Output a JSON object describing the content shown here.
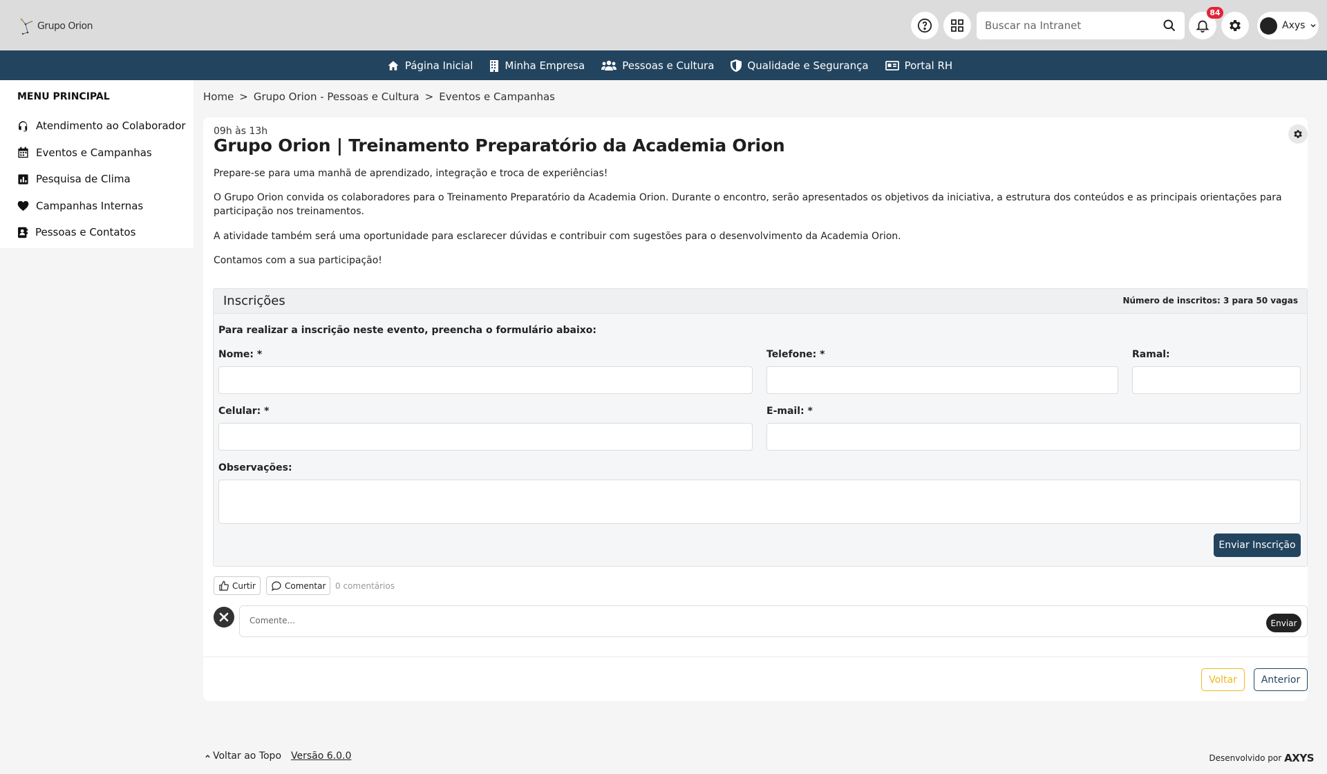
{
  "header": {
    "logo_text": "Grupo Orion",
    "search_placeholder": "Buscar na Intranet",
    "notifications_count": "84",
    "user_name": "Axys"
  },
  "nav": {
    "items": [
      {
        "label": "Página Inicial",
        "icon": "home-icon"
      },
      {
        "label": "Minha Empresa",
        "icon": "building-icon"
      },
      {
        "label": "Pessoas e Cultura",
        "icon": "users-icon"
      },
      {
        "label": "Qualidade e Segurança",
        "icon": "shield-icon"
      },
      {
        "label": "Portal RH",
        "icon": "id-card-icon"
      }
    ]
  },
  "sidebar": {
    "title": "MENU PRINCIPAL",
    "items": [
      {
        "label": "Atendimento ao Colaborador",
        "icon": "headset-icon"
      },
      {
        "label": "Eventos e Campanhas",
        "icon": "calendar-icon"
      },
      {
        "label": "Pesquisa de Clima",
        "icon": "chart-icon"
      },
      {
        "label": "Campanhas Internas",
        "icon": "heart-icon"
      },
      {
        "label": "Pessoas e Contatos",
        "icon": "contact-icon"
      }
    ]
  },
  "breadcrumb": {
    "items": [
      "Home",
      "Grupo Orion - Pessoas e Cultura",
      "Eventos e Campanhas"
    ],
    "separator": ">"
  },
  "event": {
    "time": "09h às 13h",
    "title": "Grupo Orion | Treinamento Preparatório da Academia Orion",
    "paragraphs": [
      "Prepare-se para uma manhã de aprendizado, integração e troca de experiências!",
      "O Grupo Orion convida os colaboradores para o Treinamento Preparatório da Academia Orion. Durante o encontro, serão apresentados os objetivos da iniciativa, a estrutura dos conteúdos e as principais orientações para participação nos treinamentos.",
      "A atividade também será uma oportunidade para esclarecer dúvidas e contribuir com sugestões para o desenvolvimento da Academia Orion.",
      "Contamos com a sua participação!"
    ]
  },
  "registration": {
    "title": "Inscrições",
    "count_text": "Número de inscritos: 3 para 50 vagas",
    "intro": "Para realizar a inscrição neste evento, preencha o formulário abaixo:",
    "labels": {
      "nome": "Nome: *",
      "telefone": "Telefone: *",
      "ramal": "Ramal:",
      "celular": "Celular: *",
      "email": "E-mail: *",
      "observacoes": "Observações:"
    },
    "values": {
      "nome": "",
      "telefone": "",
      "ramal": "",
      "celular": "",
      "email": "",
      "observacoes": ""
    },
    "submit_label": "Enviar Inscrição"
  },
  "social": {
    "like_label": "Curtir",
    "comment_label": "Comentar",
    "comments_count": "0 comentários",
    "comment_placeholder": "Comente...",
    "send_label": "Enviar"
  },
  "actions": {
    "back_label": "Voltar",
    "previous_label": "Anterior"
  },
  "footer": {
    "back_to_top": "Voltar ao Topo",
    "version": "Versão 6.0.0",
    "developed_by": "Desenvolvido por",
    "brand": "AXYS"
  },
  "colors": {
    "navbar": "#23445e",
    "header": "#dcdcdc",
    "badge": "#e0243a",
    "voltar_accent": "#f2b619"
  }
}
